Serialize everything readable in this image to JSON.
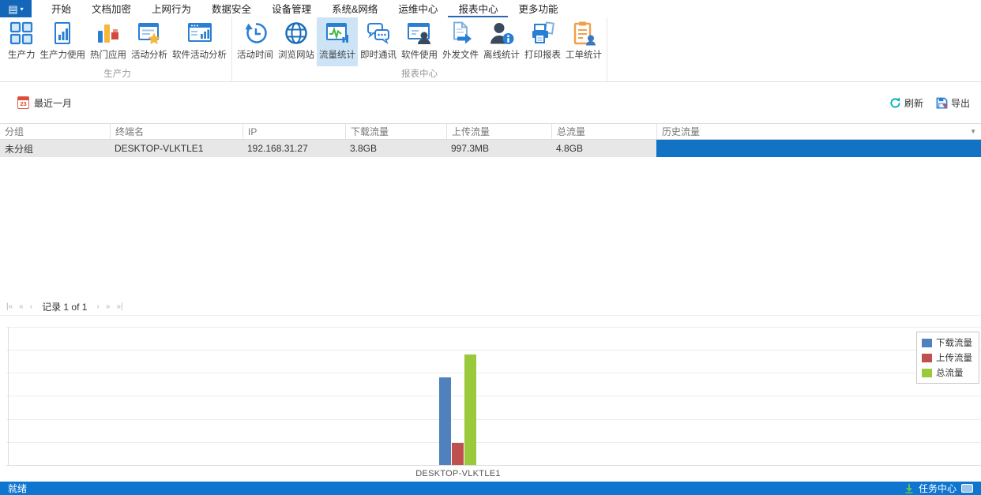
{
  "menubar": {
    "tabs": [
      {
        "label": "开始"
      },
      {
        "label": "文档加密"
      },
      {
        "label": "上网行为"
      },
      {
        "label": "数据安全"
      },
      {
        "label": "设备管理"
      },
      {
        "label": "系统&网络"
      },
      {
        "label": "运维中心"
      },
      {
        "label": "报表中心"
      },
      {
        "label": "更多功能"
      }
    ],
    "selected_tab": "报表中心"
  },
  "ribbon": {
    "groups": [
      {
        "label": "生产力",
        "buttons": [
          {
            "label": "生产力"
          },
          {
            "label": "生产力使用"
          },
          {
            "label": "热门应用"
          },
          {
            "label": "活动分析"
          },
          {
            "label": "软件活动分析"
          }
        ]
      },
      {
        "label": "报表中心",
        "buttons": [
          {
            "label": "活动时间"
          },
          {
            "label": "浏览网站"
          },
          {
            "label": "流量统计",
            "selected": true
          },
          {
            "label": "即时通讯"
          },
          {
            "label": "软件使用"
          },
          {
            "label": "外发文件"
          },
          {
            "label": "离线统计"
          },
          {
            "label": "打印报表"
          },
          {
            "label": "工单统计"
          }
        ]
      }
    ]
  },
  "toolbar": {
    "date_filter_label": "最近一月",
    "date_icon_day": "23",
    "refresh_label": "刷新",
    "export_label": "导出"
  },
  "table": {
    "columns": [
      "分组",
      "终端名",
      "IP",
      "下载流量",
      "上传流量",
      "总流量",
      "历史流量"
    ],
    "rows": [
      {
        "cells": [
          "未分组",
          "DESKTOP-VLKTLE1",
          "192.168.31.27",
          "3.8GB",
          "997.3MB",
          "4.8GB"
        ],
        "history_bar_percent": 100
      }
    ]
  },
  "pager": {
    "record_text": "记录 1 of 1",
    "icons": [
      "|«",
      "«",
      "‹",
      "›",
      "»",
      "»|"
    ]
  },
  "chart_data": {
    "type": "bar",
    "title": "",
    "xlabel": "",
    "ylabel": "",
    "unit": "GB",
    "categories": [
      "DESKTOP-VLKTLE1"
    ],
    "series": [
      {
        "name": "下载流量",
        "values": [
          3.8
        ],
        "display": "3.8GB",
        "color": "#4f81bd"
      },
      {
        "name": "上传流量",
        "values": [
          0.97
        ],
        "display": "997.3MB",
        "color": "#c0504d"
      },
      {
        "name": "总流量",
        "values": [
          4.8
        ],
        "display": "4.8GB",
        "color": "#9aca3c"
      }
    ],
    "ylim": [
      0,
      6
    ],
    "grid": true,
    "legend_position": "top-right"
  },
  "status_bar": {
    "ready_text": "就绪",
    "task_center_label": "任务中心"
  },
  "colors": {
    "accent_blue": "#2a7fd4",
    "app_button": "#1467b8",
    "selected_tab_underline": "#2468b4",
    "ribbon_selected_bg": "#cde4f7",
    "row_bg": "#e7e7e7",
    "history_bar": "#1272c4",
    "status_bar_bg": "#0f76d0",
    "refresh_icon": "#00b1b5",
    "calendar_icon": "#e04b3a"
  }
}
